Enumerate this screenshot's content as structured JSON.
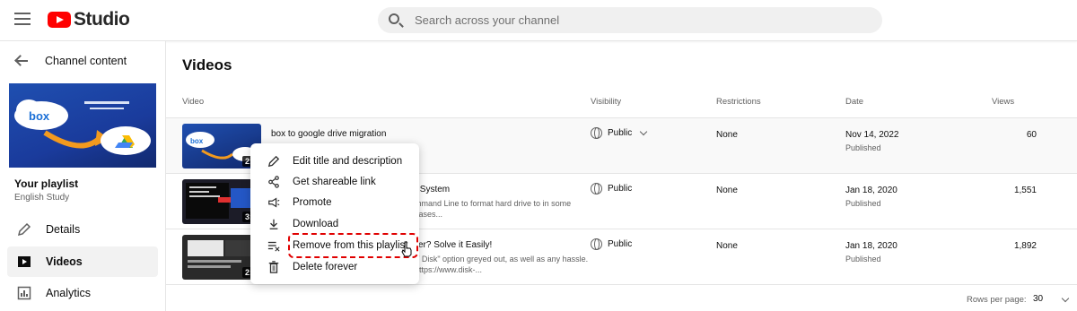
{
  "header": {
    "logo_text": "Studio",
    "search_placeholder": "Search across your channel"
  },
  "sidebar": {
    "back_label": "Channel content",
    "thumbnail_text": "box",
    "playlist_title": "Your playlist",
    "playlist_subtitle": "English Study",
    "items": [
      {
        "label": "Details",
        "icon": "pencil-icon"
      },
      {
        "label": "Videos",
        "icon": "video-icon",
        "active": true
      },
      {
        "label": "Analytics",
        "icon": "analytics-icon"
      }
    ]
  },
  "main": {
    "title": "Videos",
    "columns": [
      "Video",
      "Visibility",
      "Restrictions",
      "Date",
      "Views"
    ],
    "rows": [
      {
        "duration": "2:1",
        "title": "box to google drive migration",
        "desc": "",
        "visibility": "Public",
        "restrictions": "None",
        "date": "Nov 14, 2022",
        "status": "Published",
        "views": "60"
      },
      {
        "duration": "3:4",
        "title": "ile System",
        "desc": "mmand Line to format hard drive to in some cases...",
        "visibility": "Public",
        "restrictions": "None",
        "date": "Jan 18, 2020",
        "status": "Published",
        "views": "1,551"
      },
      {
        "duration": "2:1",
        "title": "er? Solve it Easily!",
        "desc": "T Disk\" option greyed out, as well as any hassle. https://www.disk-...",
        "visibility": "Public",
        "restrictions": "None",
        "date": "Jan 18, 2020",
        "status": "Published",
        "views": "1,892"
      }
    ],
    "footer": {
      "rows_label": "Rows per page:",
      "rows_value": "30"
    }
  },
  "context_menu": {
    "items": [
      {
        "label": "Edit title and description",
        "icon": "pencil-icon"
      },
      {
        "label": "Get shareable link",
        "icon": "share-icon"
      },
      {
        "label": "Promote",
        "icon": "megaphone-icon"
      },
      {
        "label": "Download",
        "icon": "download-icon"
      },
      {
        "label": "Remove from this playlist",
        "icon": "remove-from-playlist-icon"
      },
      {
        "label": "Delete forever",
        "icon": "trash-icon"
      }
    ]
  },
  "colors": {
    "brand_red": "#ff0000",
    "highlight_red": "#e00000",
    "text_secondary": "#606060"
  }
}
